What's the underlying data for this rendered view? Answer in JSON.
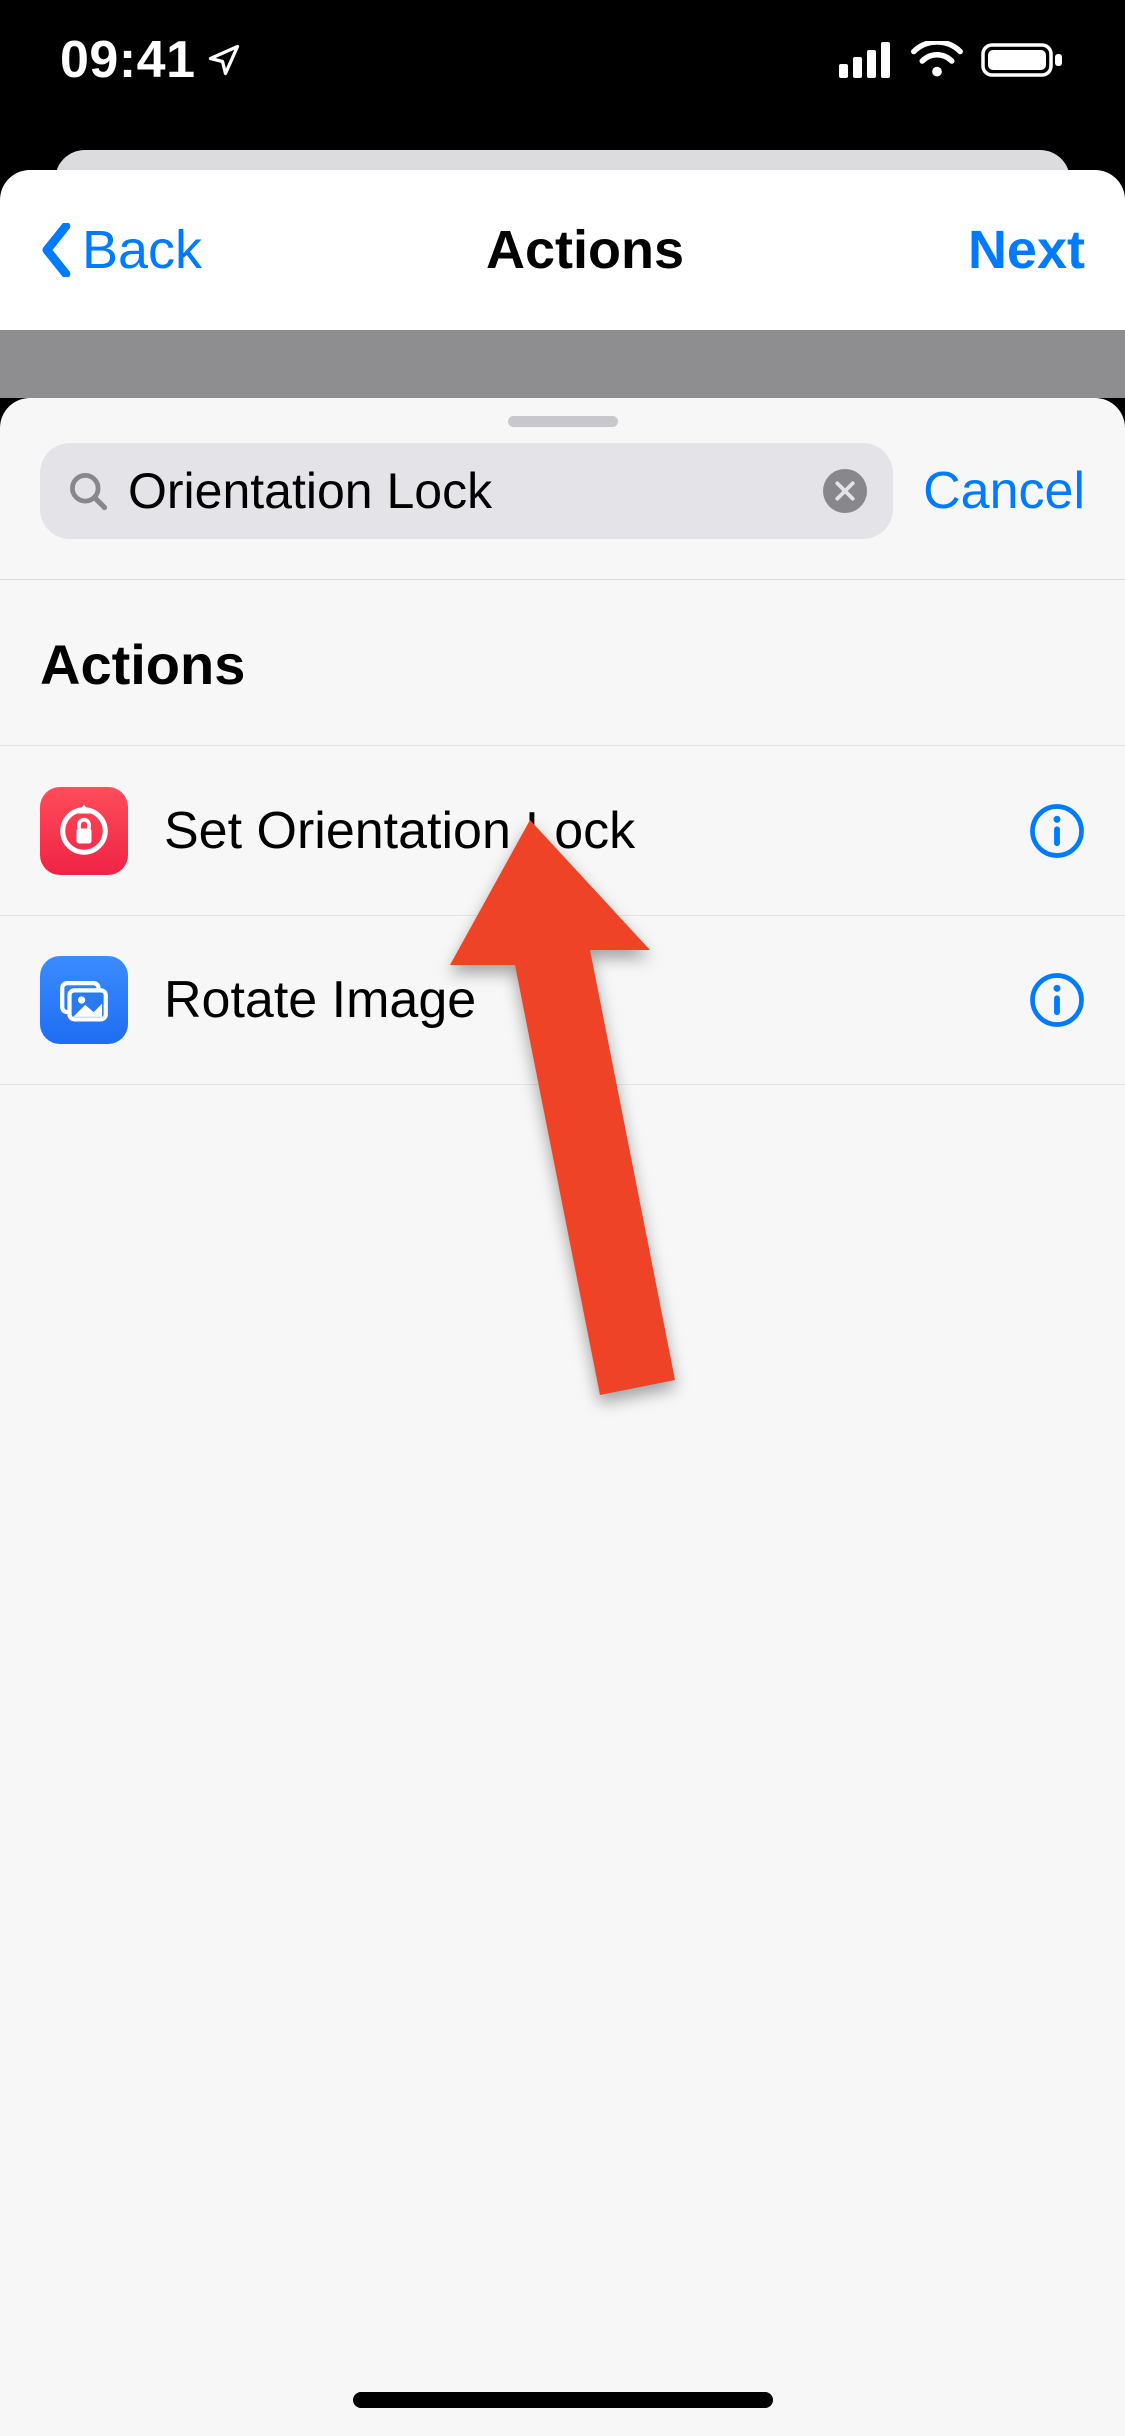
{
  "status": {
    "time": "09:41"
  },
  "nav": {
    "back": "Back",
    "title": "Actions",
    "next": "Next"
  },
  "search": {
    "query": "Orientation Lock",
    "cancel": "Cancel"
  },
  "results": {
    "header": "Actions",
    "items": [
      {
        "label": "Set Orientation Lock",
        "icon": "orientation-lock",
        "color": "red"
      },
      {
        "label": "Rotate Image",
        "icon": "image",
        "color": "blue"
      }
    ]
  }
}
